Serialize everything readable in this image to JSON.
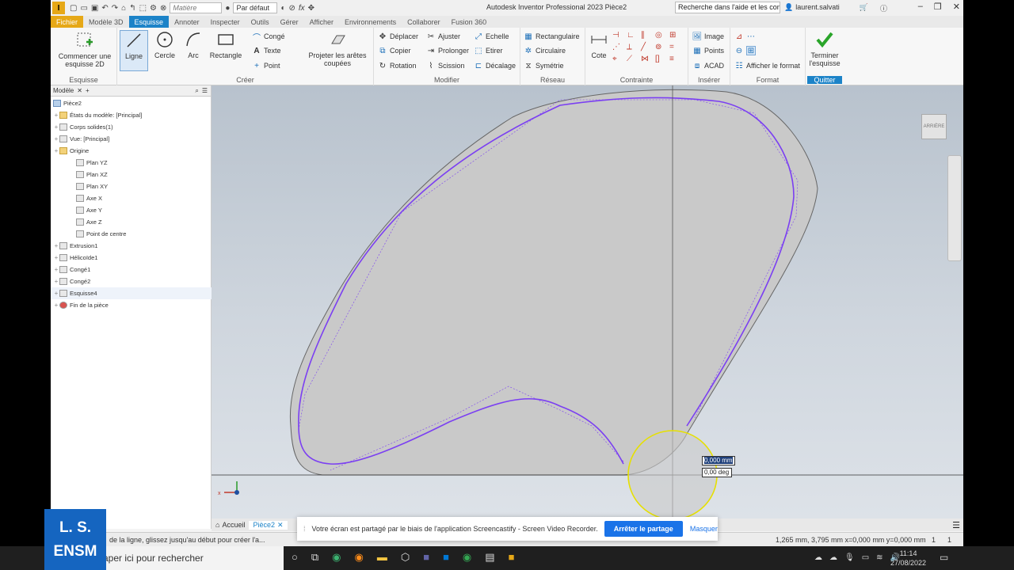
{
  "titlebar": {
    "material_placeholder": "Matière",
    "appearance": "Par défaut",
    "app_title": "Autodesk Inventor Professional 2023    Pièce2",
    "search_placeholder": "Recherche dans l'aide et les com",
    "user": "laurent.salvati"
  },
  "tabs": [
    "Fichier",
    "Modèle 3D",
    "Esquisse",
    "Annoter",
    "Inspecter",
    "Outils",
    "Gérer",
    "Afficher",
    "Environnements",
    "Collaborer",
    "Fusion 360"
  ],
  "ribbon": {
    "esquisse": {
      "start_label": "Commencer une esquisse 2D",
      "panel": "Esquisse"
    },
    "creer": {
      "ligne": "Ligne",
      "cercle": "Cercle",
      "arc": "Arc",
      "rectangle": "Rectangle",
      "conge": "Congé",
      "texte": "Texte",
      "point": "Point",
      "projeter": "Projeter les arêtes coupées",
      "panel": "Créer"
    },
    "modifier": {
      "deplacer": "Déplacer",
      "copier": "Copier",
      "rotation": "Rotation",
      "ajuster": "Ajuster",
      "prolonger": "Prolonger",
      "scission": "Scission",
      "echelle": "Echelle",
      "etirer": "Etirer",
      "decalage": "Décalage",
      "panel": "Modifier"
    },
    "reseau": {
      "rect": "Rectangulaire",
      "circ": "Circulaire",
      "sym": "Symétrie",
      "panel": "Réseau"
    },
    "contrainte": {
      "cote": "Cote",
      "panel": "Contrainte"
    },
    "inserer": {
      "image": "Image",
      "points": "Points",
      "acad": "ACAD",
      "panel": "Insérer"
    },
    "format": {
      "afficher": "Afficher le format",
      "panel": "Format"
    },
    "quitter": {
      "terminer": "Terminer l'esquisse",
      "panel": "Quitter"
    }
  },
  "browser": {
    "tab": "Modèle",
    "root": "Pièce2",
    "items": [
      {
        "label": "États du modèle: [Principal]",
        "indent": 1
      },
      {
        "label": "Corps solides(1)",
        "indent": 1
      },
      {
        "label": "Vue: [Principal]",
        "indent": 1
      },
      {
        "label": "Origine",
        "indent": 1
      },
      {
        "label": "Plan YZ",
        "indent": 2
      },
      {
        "label": "Plan XZ",
        "indent": 2
      },
      {
        "label": "Plan XY",
        "indent": 2
      },
      {
        "label": "Axe X",
        "indent": 2
      },
      {
        "label": "Axe Y",
        "indent": 2
      },
      {
        "label": "Axe Z",
        "indent": 2
      },
      {
        "label": "Point de centre",
        "indent": 2
      },
      {
        "label": "Extrusion1",
        "indent": 1
      },
      {
        "label": "Hélicoïde1",
        "indent": 1
      },
      {
        "label": "Congé1",
        "indent": 1
      },
      {
        "label": "Congé2",
        "indent": 1
      },
      {
        "label": "Esquisse4",
        "indent": 1
      },
      {
        "label": "Fin de la pièce",
        "indent": 1
      }
    ]
  },
  "viewport": {
    "viewcube_label": "ARRIÈRE",
    "dim_length": "0,000 mm",
    "dim_angle": "0,00 deg"
  },
  "doc_tabs": {
    "home": "Accueil",
    "doc": "Pièce2"
  },
  "status": {
    "prompt": "de la ligne, glissez jusqu'au début pour créer l'a...",
    "coords": "1,265 mm, 3,795 mm  x=0,000 mm  y=0,000 mm",
    "n1": "1",
    "n2": "1"
  },
  "share_bar": {
    "text": "Votre écran est partagé par le biais de l'application Screencastify - Screen Video Recorder.",
    "stop": "Arrêter le partage",
    "hide": "Masquer"
  },
  "taskbar": {
    "search": "Taper ici pour rechercher",
    "time": "11:14",
    "date": "27/08/2022"
  },
  "badge": {
    "line1": "L. S.",
    "line2": "ENSM"
  },
  "colors": {
    "accent": "#1c83c8",
    "sketch": "#7b3ff2",
    "file_tab": "#e6a817"
  }
}
